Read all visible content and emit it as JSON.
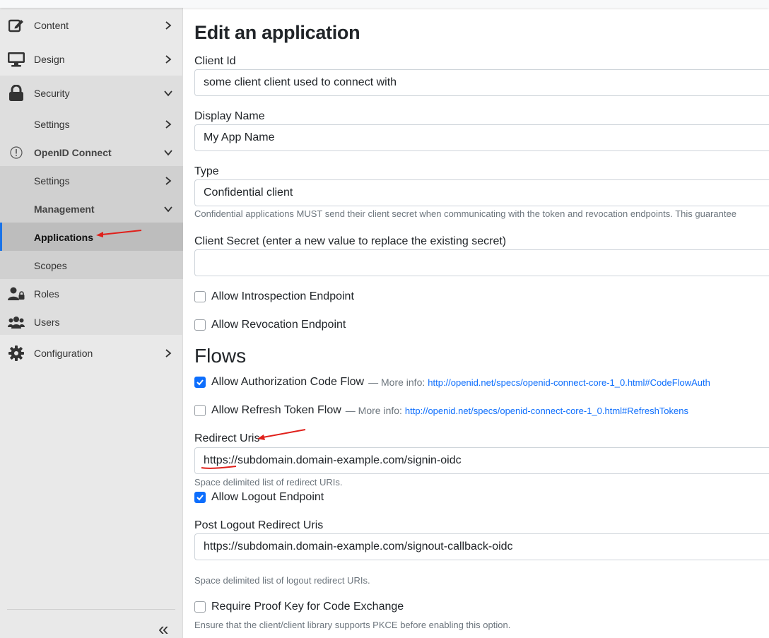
{
  "sidebar": {
    "items": [
      {
        "label": "Content"
      },
      {
        "label": "Design"
      },
      {
        "label": "Security"
      },
      {
        "label": "Settings"
      },
      {
        "label": "OpenID Connect"
      },
      {
        "label": "Settings"
      },
      {
        "label": "Management"
      },
      {
        "label": "Applications"
      },
      {
        "label": "Scopes"
      },
      {
        "label": "Roles"
      },
      {
        "label": "Users"
      },
      {
        "label": "Configuration"
      }
    ],
    "collapse_glyph": "«"
  },
  "page": {
    "title": "Edit an application",
    "client_id": {
      "label": "Client Id",
      "value": "some client client used to connect with"
    },
    "display_name": {
      "label": "Display Name",
      "value": "My App Name"
    },
    "type": {
      "label": "Type",
      "value": "Confidential client",
      "help": "Confidential applications MUST send their client secret when communicating with the token and revocation endpoints. This guarantee"
    },
    "client_secret": {
      "label": "Client Secret (enter a new value to replace the existing secret)",
      "value": ""
    },
    "introspection": {
      "label": "Allow Introspection Endpoint",
      "checked": false
    },
    "revocation": {
      "label": "Allow Revocation Endpoint",
      "checked": false
    },
    "flows_heading": "Flows",
    "auth_code": {
      "label": "Allow Authorization Code Flow",
      "more": "— More info:",
      "link": "http://openid.net/specs/openid-connect-core-1_0.html#CodeFlowAuth",
      "checked": true
    },
    "refresh": {
      "label": "Allow Refresh Token Flow",
      "more": "— More info:",
      "link": "http://openid.net/specs/openid-connect-core-1_0.html#RefreshTokens",
      "checked": false
    },
    "redirect_uris": {
      "label": "Redirect Uris",
      "value": "https://subdomain.domain-example.com/signin-oidc",
      "help": "Space delimited list of redirect URIs."
    },
    "logout": {
      "label": "Allow Logout Endpoint",
      "checked": true
    },
    "post_logout": {
      "label": "Post Logout Redirect Uris",
      "value": "https://subdomain.domain-example.com/signout-callback-oidc",
      "help": "Space delimited list of logout redirect URIs."
    },
    "pkce": {
      "label": "Require Proof Key for Code Exchange",
      "help": "Ensure that the client/client library supports PKCE before enabling this option.",
      "checked": false
    }
  },
  "colors": {
    "accent": "#0d6efd",
    "annotation": "#e0201b",
    "sidebar_bg": "#e9e9e9",
    "active": "#bdbdbd"
  }
}
